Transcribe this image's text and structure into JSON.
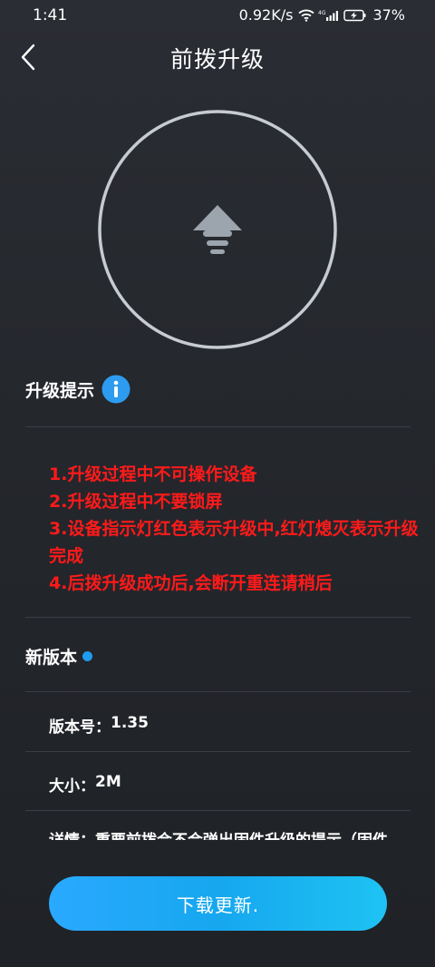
{
  "status_bar": {
    "time": "1:41",
    "net_speed": "0.92K/s",
    "battery": "37%",
    "icons": [
      "wifi-icon",
      "signal-4g-icon",
      "battery-charging-icon"
    ]
  },
  "header": {
    "title": "前拨升级",
    "back_icon": "chevron-left-icon"
  },
  "upgrade_ring": {
    "icon": "upload-arrow-icon"
  },
  "tips": {
    "heading": "升级提示",
    "info_icon": "info-icon",
    "items": [
      "1.升级过程中不可操作设备",
      "2.升级过程中不要锁屏",
      "3.设备指示灯红色表示升级中,红灯熄灭表示升级完成",
      "4.后拨升级成功后,会断开重连请稍后"
    ]
  },
  "new_version": {
    "heading": "新版本",
    "version_label": "版本号：",
    "version_value": "1.35",
    "size_label": "大小：",
    "size_value": "2M",
    "details_text": "详情：重要前拨会不会弹出固件升级的提示（固件"
  },
  "cta": {
    "label": "下载更新."
  },
  "colors": {
    "accent": "#1aa3f0",
    "warning": "#ff1a1a",
    "background": "#26292e",
    "dot": "#1f9bf0"
  }
}
